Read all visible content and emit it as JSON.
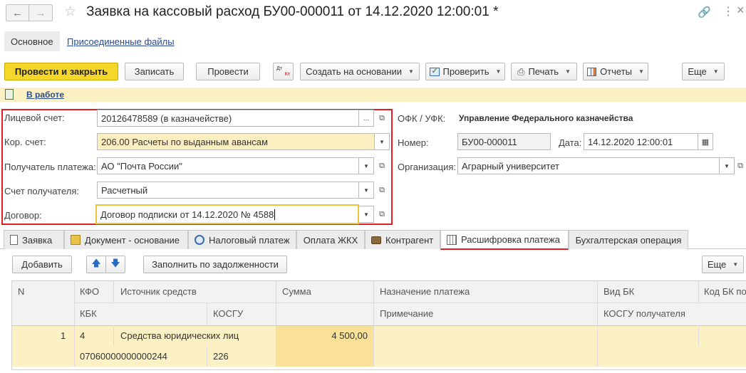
{
  "window": {
    "title": "Заявка на кассовый расход БУ00-000011 от 14.12.2020 12:00:01 *"
  },
  "subnav": {
    "main": "Основное",
    "files": "Присоединенные файлы"
  },
  "toolbar": {
    "post_close": "Провести и закрыть",
    "save": "Записать",
    "post": "Провести",
    "dt_kt_top": "Дт",
    "dt_kt_bottom": "Кт",
    "create_based": "Создать на основании",
    "check": "Проверить",
    "print": "Печать",
    "reports": "Отчеты",
    "more": "Еще"
  },
  "status": {
    "text": "В работе"
  },
  "form": {
    "account_label": "Лицевой счет:",
    "account_value": "20126478589 (в казначействе)",
    "corr_label": "Кор. счет:",
    "corr_value": "206.00 Расчеты по выданным авансам",
    "payee_label": "Получатель платежа:",
    "payee_value": "АО \"Почта России\"",
    "payee_acc_label": "Счет получателя:",
    "payee_acc_value": "Расчетный",
    "contract_label": "Договор:",
    "contract_value": "Договор подписки от 14.12.2020 № 4588",
    "ofk_label": "ОФК / УФК:",
    "ofk_value": "Управление Федерального казначейства",
    "number_label": "Номер:",
    "number_value": "БУ00-000011",
    "date_label": "Дата:",
    "date_value": "14.12.2020 12:00:01",
    "org_label": "Организация:",
    "org_value": "Аграрный университет"
  },
  "tabs": [
    {
      "label": "Заявка"
    },
    {
      "label": "Документ - основание"
    },
    {
      "label": "Налоговый платеж"
    },
    {
      "label": "Оплата ЖКХ"
    },
    {
      "label": "Контрагент"
    },
    {
      "label": "Расшифровка платежа"
    },
    {
      "label": "Бухгалтерская операция"
    }
  ],
  "table_toolbar": {
    "add": "Добавить",
    "fill": "Заполнить по задолженности",
    "more": "Еще"
  },
  "table": {
    "headers": {
      "n": "N",
      "kfo": "КФО",
      "source": "Источник средств",
      "sum": "Сумма",
      "purpose": "Назначение платежа",
      "vid_bk": "Вид БК",
      "kod_bk": "Код БК по",
      "kbk": "КБК",
      "kosgu": "КОСГУ",
      "note": "Примечание",
      "kosgu_recv": "КОСГУ получателя"
    },
    "rows": [
      {
        "n": "1",
        "kfo": "4",
        "source": "Средства юридических лиц",
        "sum": "4 500,00",
        "kbk": "07060000000000244",
        "kosgu": "226"
      }
    ]
  },
  "colors": {
    "accent_yellow": "#f5d62b",
    "highlight_red": "#e02020",
    "row_yellow": "#fbf1c4"
  }
}
